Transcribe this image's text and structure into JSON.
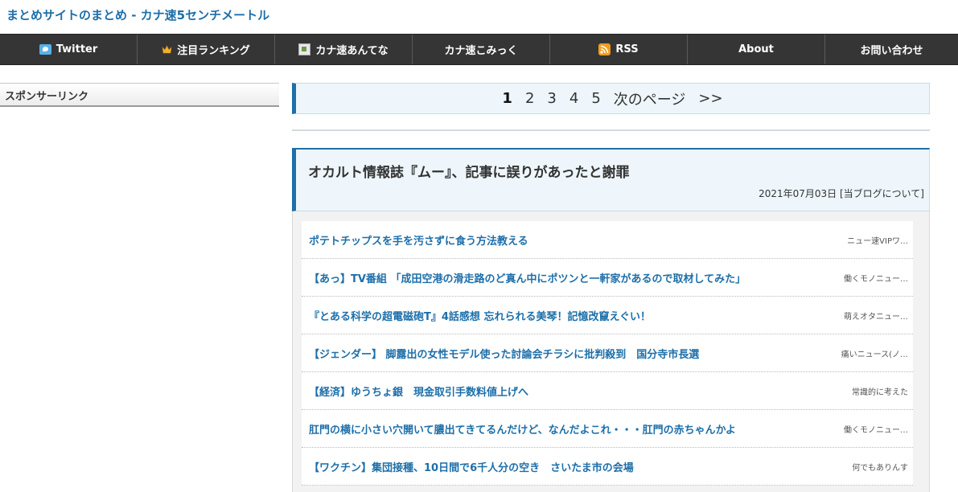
{
  "site": {
    "title": "まとめサイトのまとめ - カナ速5センチメートル"
  },
  "nav": {
    "items": [
      {
        "label": "Twitter",
        "icon": "twitter-icon"
      },
      {
        "label": "注目ランキング",
        "icon": "crown-icon"
      },
      {
        "label": "カナ速あんてな",
        "icon": "broken-image-icon"
      },
      {
        "label": "カナ速こみっく",
        "icon": ""
      },
      {
        "label": "RSS",
        "icon": "rss-icon"
      },
      {
        "label": "About",
        "icon": ""
      },
      {
        "label": "お問い合わせ",
        "icon": ""
      }
    ]
  },
  "sidebar": {
    "heading": "スポンサーリンク"
  },
  "pager": {
    "pages": [
      "1",
      "2",
      "3",
      "4",
      "5"
    ],
    "current": "1",
    "next_label": "次のページ",
    "last_label": ">>"
  },
  "article": {
    "title": "オカルト情報誌『ムー』、記事に誤りがあったと謝罪",
    "date": "2021年07月03日",
    "category": "[当ブログについて]"
  },
  "links": [
    {
      "title": "ポテトチップスを手を汚さずに食う方法教える",
      "source": "ニュー速VIPワ…"
    },
    {
      "title": "【あっ】TV番組 「成田空港の滑走路のど真ん中にポツンと一軒家があるので取材してみた」",
      "source": "働くモノニュー…"
    },
    {
      "title": "『とある科学の超電磁砲T』4話感想 忘れられる美琴！記憶改竄えぐい！",
      "source": "萌えオタニュー…"
    },
    {
      "title": "【ジェンダー】 脚露出の女性モデル使った討論会チラシに批判殺到　国分寺市長選",
      "source": "痛いニュース(ノ…"
    },
    {
      "title": "【経済】ゆうちょ銀　現金取引手数料値上げへ",
      "source": "常識的に考えた"
    },
    {
      "title": "肛門の横に小さい穴開いて膿出てきてるんだけど、なんだよこれ・・・肛門の赤ちゃんかよ",
      "source": "働くモノニュー…"
    },
    {
      "title": "【ワクチン】集団接種、10日間で6千人分の空き　さいたま市の会場",
      "source": "何でもありんす"
    }
  ]
}
